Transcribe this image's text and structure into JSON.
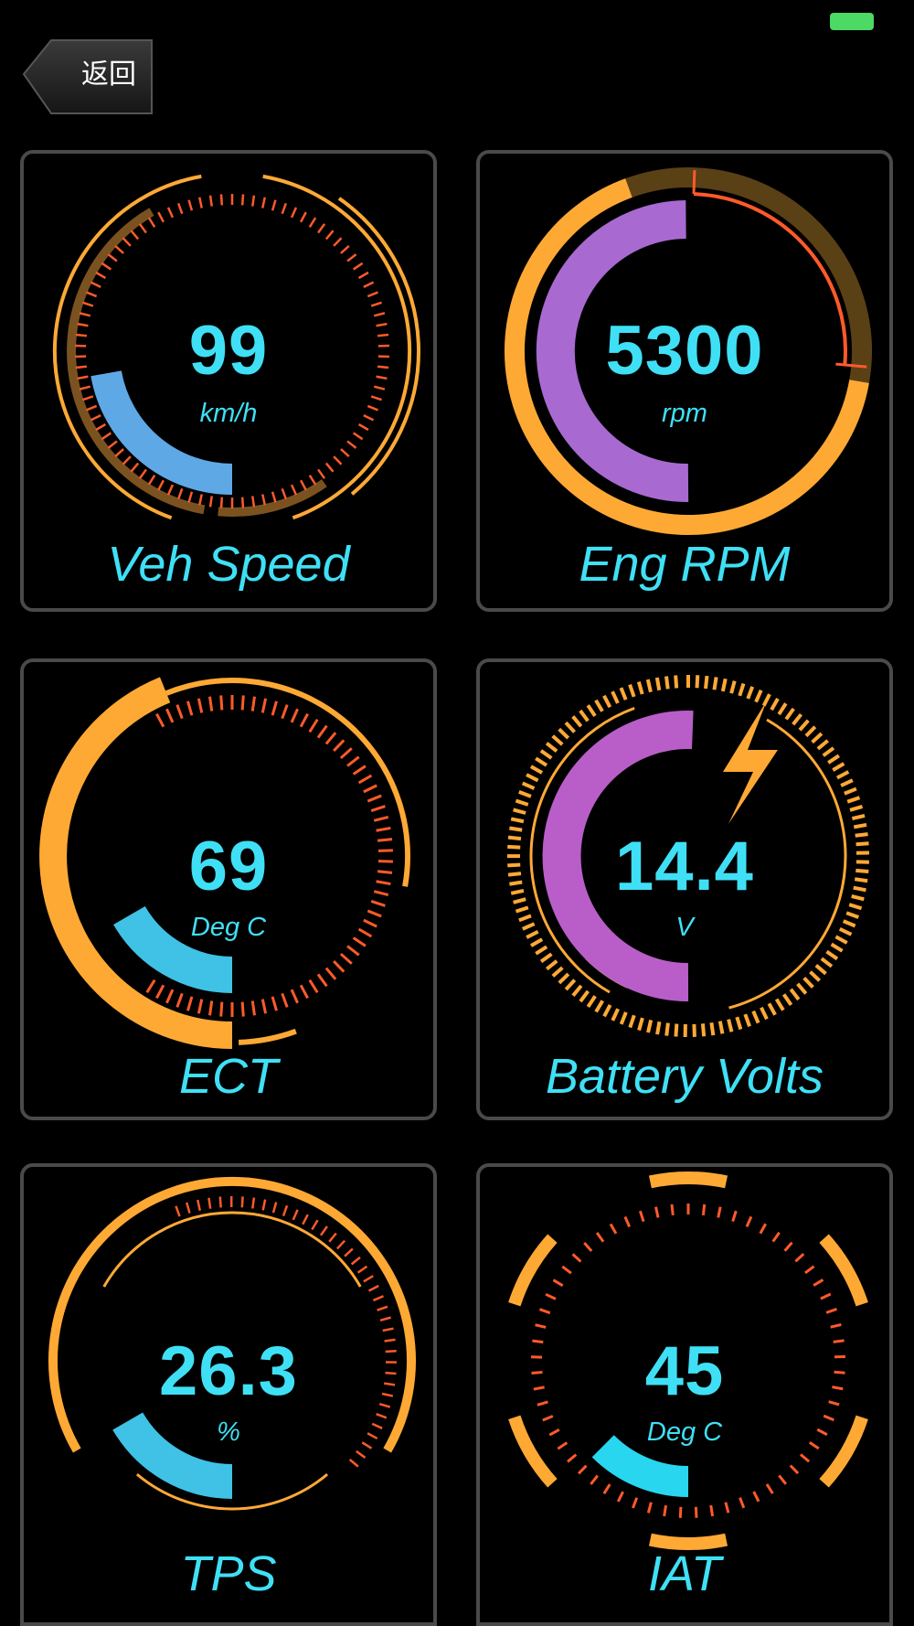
{
  "status_bar": {
    "battery_color": "#4cd964"
  },
  "nav": {
    "back_label": "返回"
  },
  "colors": {
    "frame": "#ffa935",
    "ticks": "#ff5a2a",
    "text": "#3fe0f5",
    "speed_arc": "#5fa8e6",
    "rpm_arc": "#a86ad0",
    "volts_arc": "#b95ec8",
    "temp_arc": "#3fc2e6",
    "iat_arc": "#28d6f0"
  },
  "gauges": [
    {
      "title": "Veh Speed",
      "value": "99",
      "unit": "km/h",
      "icon": ""
    },
    {
      "title": "Eng RPM",
      "value": "5300",
      "unit": "rpm",
      "icon": ""
    },
    {
      "title": "ECT",
      "value": "69",
      "unit": "Deg C",
      "icon": ""
    },
    {
      "title": "Battery Volts",
      "value": "14.4",
      "unit": "V",
      "icon": "lightning-bolt-icon"
    },
    {
      "title": "TPS",
      "value": "26.3",
      "unit": "%",
      "icon": ""
    },
    {
      "title": "IAT",
      "value": "45",
      "unit": "Deg C",
      "icon": ""
    }
  ]
}
